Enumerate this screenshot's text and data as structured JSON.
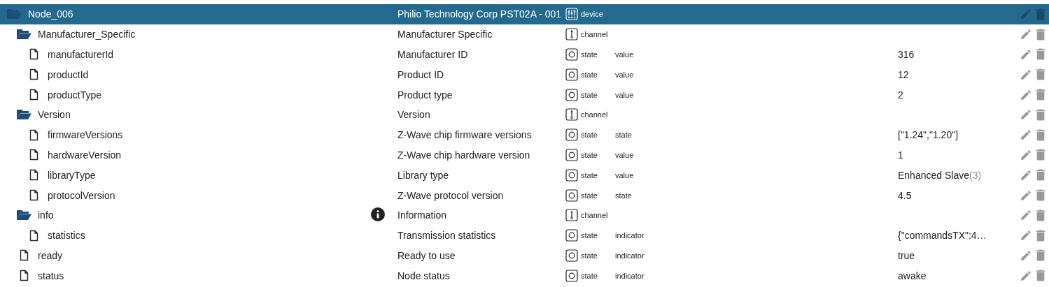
{
  "tree": [
    {
      "kind": "folder",
      "name": "Node_006",
      "description": "Philio Technology Corp PST02A - 001",
      "type": "device",
      "expanded": true,
      "selected": true,
      "children": [
        {
          "kind": "folder",
          "name": "Manufacturer_Specific",
          "description": "Manufacturer Specific",
          "type": "channel",
          "expanded": true,
          "selected": false,
          "children": [
            {
              "kind": "file",
              "name": "manufacturerId",
              "description": "Manufacturer ID",
              "type": "state",
              "role": "value",
              "value": "316",
              "selected": false
            },
            {
              "kind": "file",
              "name": "productId",
              "description": "Product ID",
              "type": "state",
              "role": "value",
              "value": "12",
              "selected": false
            },
            {
              "kind": "file",
              "name": "productType",
              "description": "Product type",
              "type": "state",
              "role": "value",
              "value": "2",
              "selected": false
            }
          ]
        },
        {
          "kind": "folder",
          "name": "Version",
          "description": "Version",
          "type": "channel",
          "expanded": true,
          "selected": false,
          "children": [
            {
              "kind": "file",
              "name": "firmwareVersions",
              "description": "Z-Wave chip firmware versions",
              "type": "state",
              "role": "state",
              "value": "[\"1.24\",\"1.20\"]",
              "selected": false
            },
            {
              "kind": "file",
              "name": "hardwareVersion",
              "description": "Z-Wave chip hardware version",
              "type": "state",
              "role": "value",
              "value": "1",
              "selected": false
            },
            {
              "kind": "file",
              "name": "libraryType",
              "description": "Library type",
              "type": "state",
              "role": "value",
              "value": "Enhanced Slave",
              "value_note": "(3)",
              "selected": false
            },
            {
              "kind": "file",
              "name": "protocolVersion",
              "description": "Z-Wave protocol version",
              "type": "state",
              "role": "state",
              "value": "4.5",
              "selected": false
            }
          ]
        },
        {
          "kind": "folder",
          "name": "info",
          "description": "Information",
          "info_icon": true,
          "type": "channel",
          "expanded": true,
          "selected": false,
          "children": [
            {
              "kind": "file",
              "name": "statistics",
              "description": "Transmission statistics",
              "type": "state",
              "role": "indicator",
              "value": "{\"commandsTX\":4…",
              "selected": false
            }
          ]
        },
        {
          "kind": "file",
          "name": "ready",
          "description": "Ready to use",
          "type": "state",
          "role": "indicator",
          "value": "true",
          "selected": false
        },
        {
          "kind": "file",
          "name": "status",
          "description": "Node status",
          "type": "state",
          "role": "indicator",
          "value": "awake",
          "selected": false
        }
      ]
    }
  ]
}
